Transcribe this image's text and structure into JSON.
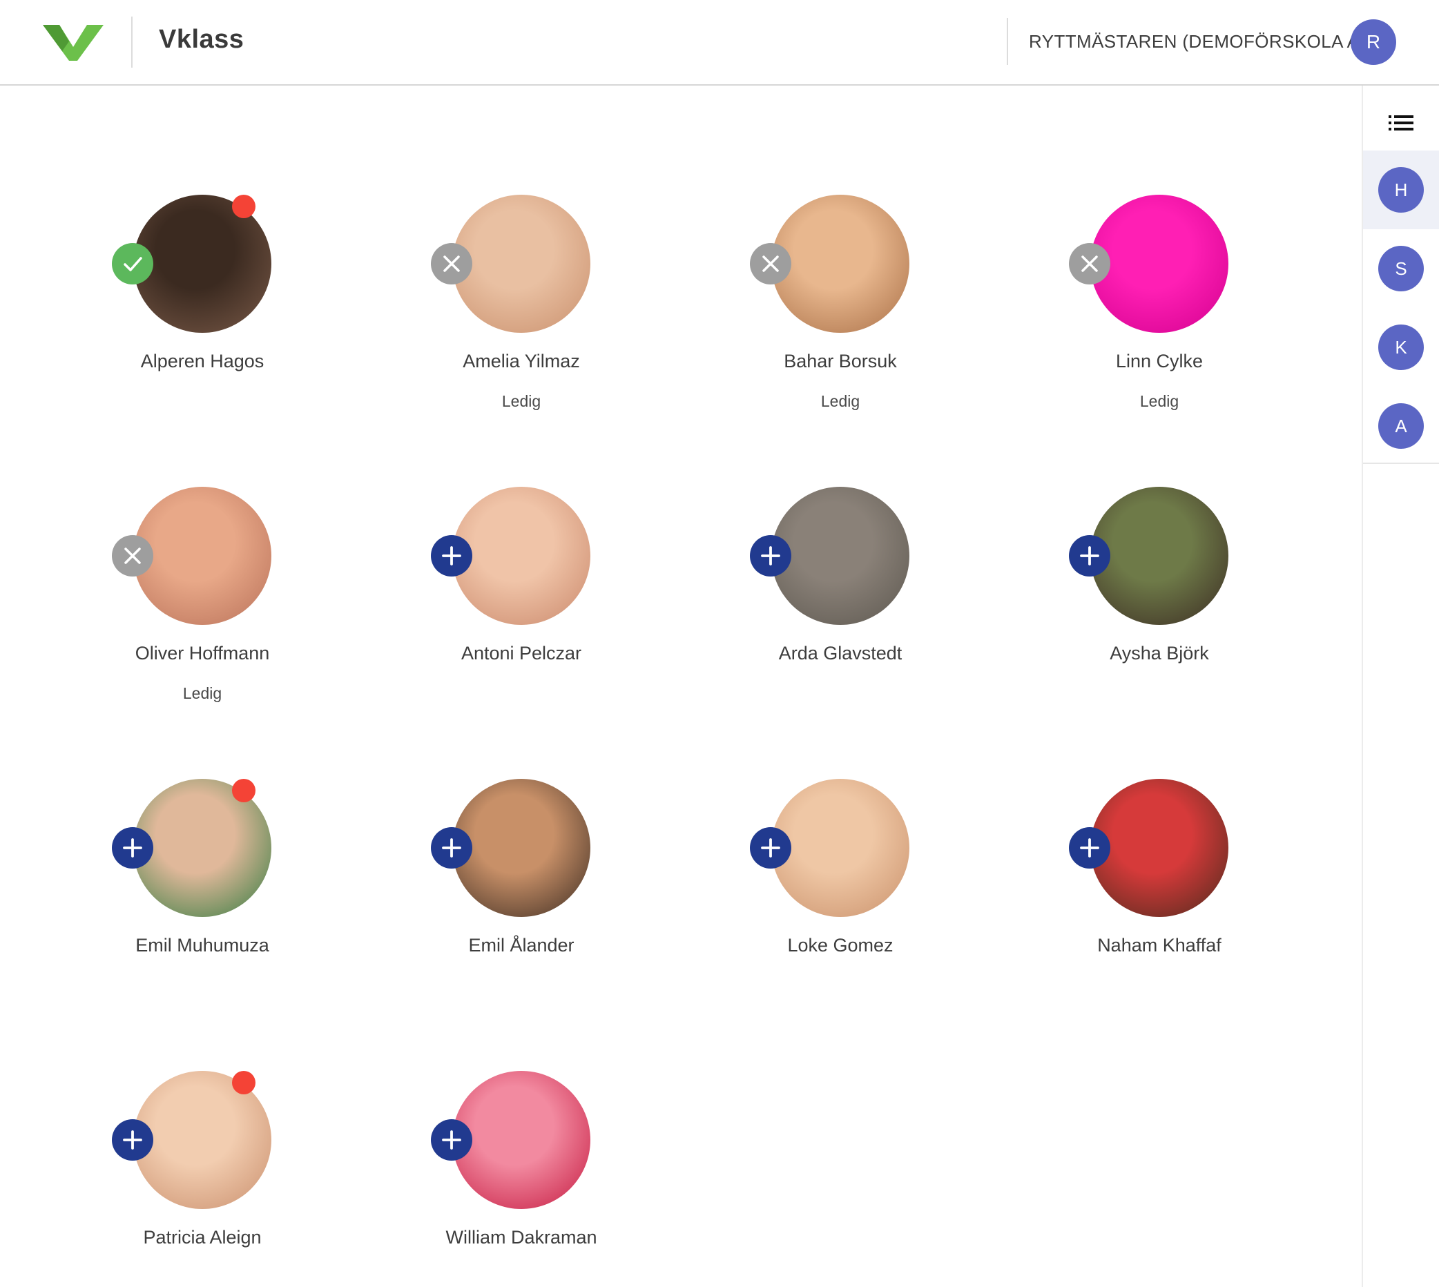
{
  "app": {
    "brand": "Vklass",
    "brand_color": "#6cc04a"
  },
  "header": {
    "school": "RYTTMÄSTAREN (DEMOFÖRSKOLA A)",
    "user_initial": "R"
  },
  "sidebar": {
    "list_icon": "list-icon",
    "groups": [
      {
        "initial": "H",
        "active": true
      },
      {
        "initial": "S",
        "active": false
      },
      {
        "initial": "K",
        "active": false
      },
      {
        "initial": "A",
        "active": false
      }
    ]
  },
  "children": [
    {
      "name": "Alperen Hagos",
      "status": "",
      "badge": "present",
      "notification": true,
      "photo": [
        "#3b2a20",
        "#7a5a48"
      ]
    },
    {
      "name": "Amelia Yilmaz",
      "status": "Ledig",
      "badge": "absent",
      "notification": false,
      "photo": [
        "#e9c0a2",
        "#c98f6c"
      ]
    },
    {
      "name": "Bahar Borsuk",
      "status": "Ledig",
      "badge": "absent",
      "notification": false,
      "photo": [
        "#e8b78e",
        "#a86e45"
      ]
    },
    {
      "name": "Linn Cylke",
      "status": "Ledig",
      "badge": "absent",
      "notification": false,
      "photo": [
        "#ff1fb4",
        "#d2008e"
      ]
    },
    {
      "name": "Oliver Hoffmann",
      "status": "Ledig",
      "badge": "absent",
      "notification": false,
      "photo": [
        "#e8a888",
        "#b87058"
      ]
    },
    {
      "name": "Antoni Pelczar",
      "status": "",
      "badge": "add",
      "notification": false,
      "photo": [
        "#f0c4a8",
        "#c9876a"
      ]
    },
    {
      "name": "Arda Glavstedt",
      "status": "",
      "badge": "add",
      "notification": false,
      "photo": [
        "#8a8178",
        "#5c574f"
      ]
    },
    {
      "name": "Aysha Björk",
      "status": "",
      "badge": "add",
      "notification": false,
      "photo": [
        "#6e7a48",
        "#3a2a22"
      ]
    },
    {
      "name": "Emil Muhumuza",
      "status": "",
      "badge": "add",
      "notification": true,
      "photo": [
        "#e0b89a",
        "#2f7a3e"
      ]
    },
    {
      "name": "Emil Ålander",
      "status": "",
      "badge": "add",
      "notification": false,
      "photo": [
        "#c89068",
        "#3a2a20"
      ]
    },
    {
      "name": "Loke Gomez",
      "status": "",
      "badge": "add",
      "notification": false,
      "photo": [
        "#efc7a5",
        "#c9906a"
      ]
    },
    {
      "name": "Naham Khaffaf",
      "status": "",
      "badge": "add",
      "notification": false,
      "photo": [
        "#d63a3a",
        "#4a2a1c"
      ]
    },
    {
      "name": "Patricia Aleign",
      "status": "",
      "badge": "add",
      "notification": true,
      "photo": [
        "#f2cdb0",
        "#c98e6c"
      ]
    },
    {
      "name": "William Dakraman",
      "status": "",
      "badge": "add",
      "notification": false,
      "photo": [
        "#f28aa0",
        "#c4173e"
      ]
    }
  ]
}
